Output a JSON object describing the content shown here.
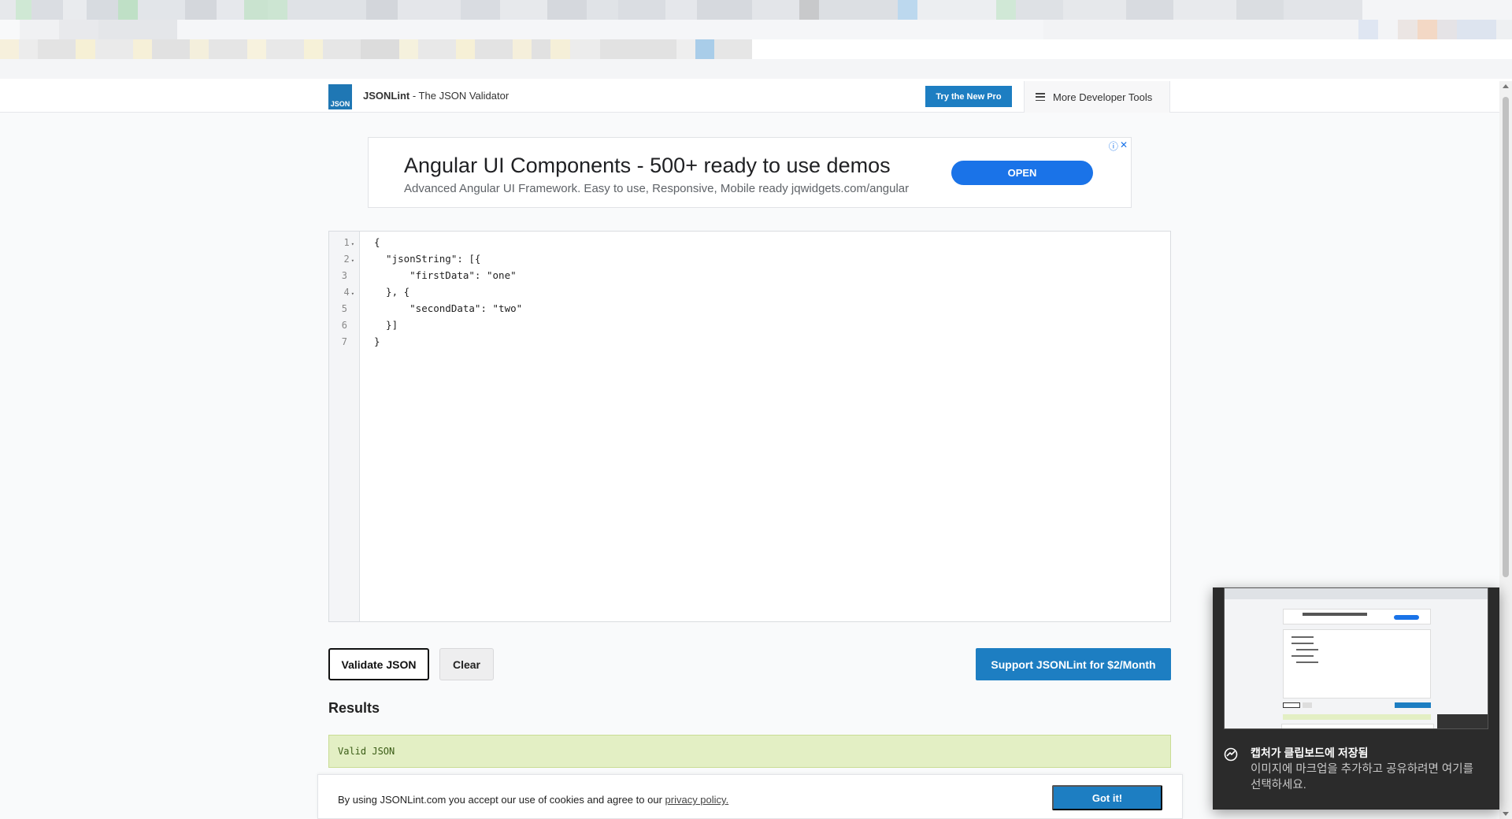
{
  "topbar": {
    "logo_text": "JSON",
    "brand_name": "JSONLint",
    "brand_tagline": " - The JSON Validator",
    "try_pro_label": "Try the New Pro",
    "more_tools_label": "More Developer Tools"
  },
  "ad": {
    "title": "Angular UI Components - 500+ ready to use demos",
    "subtitle": "Advanced Angular UI Framework. Easy to use, Responsive, Mobile ready jqwidgets.com/angular",
    "open_label": "OPEN",
    "info_glyph": "ⓘ",
    "close_glyph": "✕"
  },
  "editor": {
    "lines": [
      {
        "number": "1",
        "fold": true,
        "text": "{"
      },
      {
        "number": "2",
        "fold": true,
        "text": "  \"jsonString\": [{"
      },
      {
        "number": "3",
        "fold": false,
        "text": "      \"firstData\": \"one\""
      },
      {
        "number": "4",
        "fold": true,
        "text": "  }, {"
      },
      {
        "number": "5",
        "fold": false,
        "text": "      \"secondData\": \"two\""
      },
      {
        "number": "6",
        "fold": false,
        "text": "  }]"
      },
      {
        "number": "7",
        "fold": false,
        "text": "}"
      }
    ],
    "fold_glyph": "▾"
  },
  "actions": {
    "validate_label": "Validate JSON",
    "clear_label": "Clear",
    "support_label": "Support JSONLint for $2/Month"
  },
  "results": {
    "heading": "Results",
    "message": "Valid JSON"
  },
  "cookie": {
    "text": "By using JSONLint.com you accept our use of cookies and agree to our ",
    "link_label": "privacy policy.",
    "button_label": "Got it!"
  },
  "toast": {
    "title": "캡처가 클립보드에 저장됨",
    "body": "이미지에 마크업을 추가하고 공유하려면 여기를 선택하세요."
  },
  "colors": {
    "accent_blue": "#1d7ec2",
    "ad_blue": "#1a73e8",
    "result_bg": "#e3efc4",
    "toast_bg": "#2b2b2b"
  }
}
